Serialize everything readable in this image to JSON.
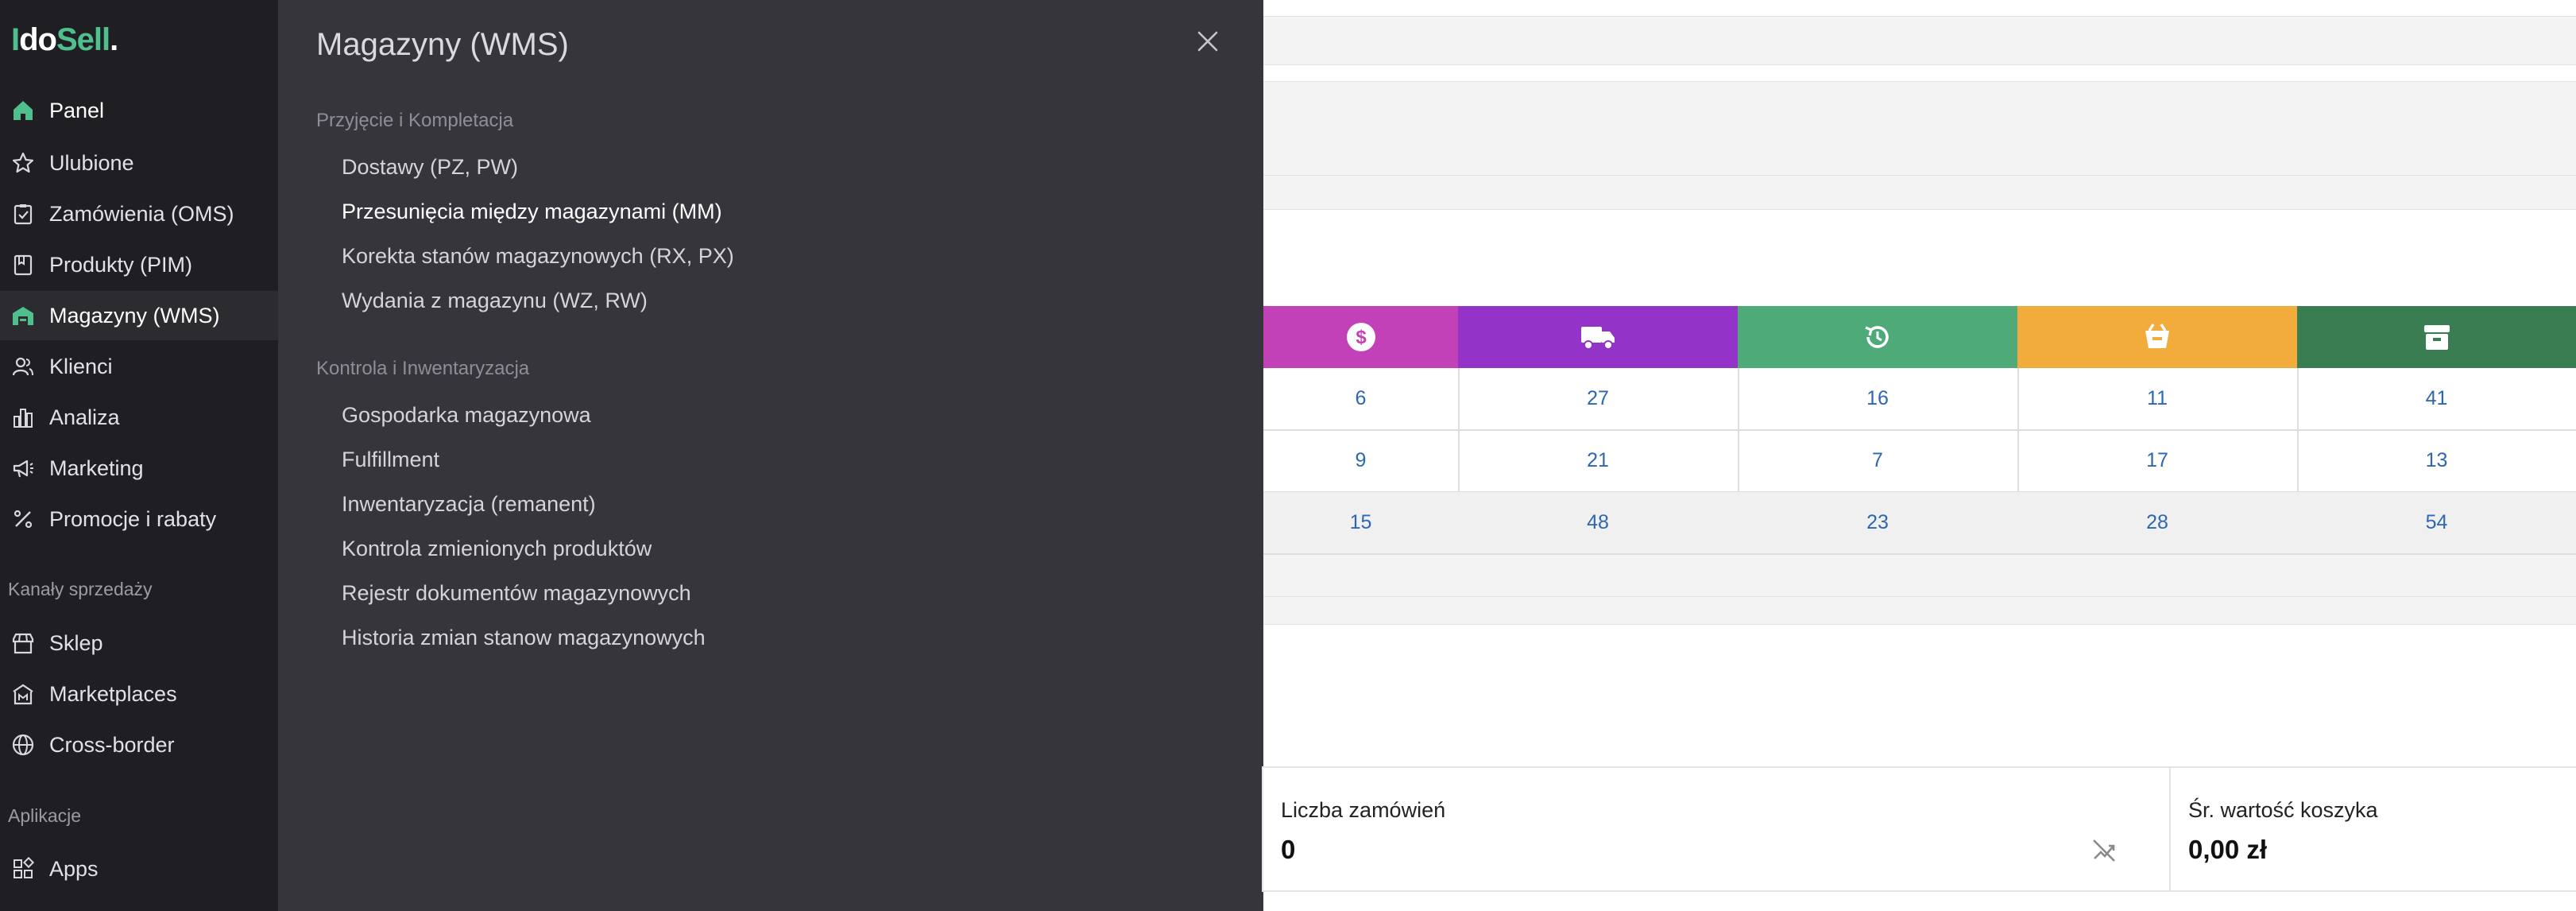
{
  "brand": {
    "logo_i": "I",
    "logo_do": "do",
    "logo_sell": "Sell",
    "logo_dot": ".",
    "accent": "#4fc08d"
  },
  "sidebar": {
    "items": [
      {
        "label": "Panel",
        "icon": "home-icon"
      },
      {
        "label": "Ulubione",
        "icon": "star-icon"
      },
      {
        "label": "Zamówienia (OMS)",
        "icon": "clipboard-check-icon"
      },
      {
        "label": "Produkty (PIM)",
        "icon": "book-icon"
      },
      {
        "label": "Magazyny (WMS)",
        "icon": "warehouse-icon"
      },
      {
        "label": "Klienci",
        "icon": "users-icon"
      },
      {
        "label": "Analiza",
        "icon": "bar-chart-icon"
      },
      {
        "label": "Marketing",
        "icon": "megaphone-icon"
      },
      {
        "label": "Promocje i rabaty",
        "icon": "percent-icon"
      }
    ],
    "section_sales": "Kanały sprzedaży",
    "sales_items": [
      {
        "label": "Sklep",
        "icon": "store-icon"
      },
      {
        "label": "Marketplaces",
        "icon": "marketplace-icon"
      },
      {
        "label": "Cross-border",
        "icon": "globe-icon"
      }
    ],
    "section_apps": "Aplikacje",
    "apps_items": [
      {
        "label": "Apps",
        "icon": "apps-grid-icon"
      }
    ]
  },
  "submenu": {
    "title": "Magazyny (WMS)",
    "groups": [
      {
        "title": "Przyjęcie i Kompletacja",
        "links": [
          "Dostawy (PZ, PW)",
          "Przesunięcia między magazynami (MM)",
          "Korekta stanów magazynowych (RX, PX)",
          "Wydania z magazynu (WZ, RW)"
        ]
      },
      {
        "title": "Kontrola i Inwentaryzacja",
        "links": [
          "Gospodarka magazynowa",
          "Fulfillment",
          "Inwentaryzacja (remanent)",
          "Kontrola zmienionych produktów",
          "Rejestr dokumentów magazynowych",
          "Historia zmian stanow magazynowych"
        ]
      }
    ]
  },
  "stats": {
    "columns": [
      {
        "icon": "dollar-circle-icon",
        "color": "#c341b6"
      },
      {
        "icon": "truck-icon",
        "color": "#9333c8"
      },
      {
        "icon": "history-icon",
        "color": "#4faa7a"
      },
      {
        "icon": "basket-icon",
        "color": "#f2ac3c"
      },
      {
        "icon": "archive-icon",
        "color": "#3a7d52"
      }
    ],
    "rows": [
      [
        "6",
        "27",
        "16",
        "11",
        "41"
      ],
      [
        "9",
        "21",
        "7",
        "17",
        "13"
      ],
      [
        "15",
        "48",
        "23",
        "28",
        "54"
      ]
    ]
  },
  "cards": [
    {
      "label": "Liczba zamówień",
      "value": "0",
      "icon": "no-trend-icon"
    },
    {
      "label": "Śr. wartość koszyka",
      "value": "0,00 zł"
    }
  ]
}
